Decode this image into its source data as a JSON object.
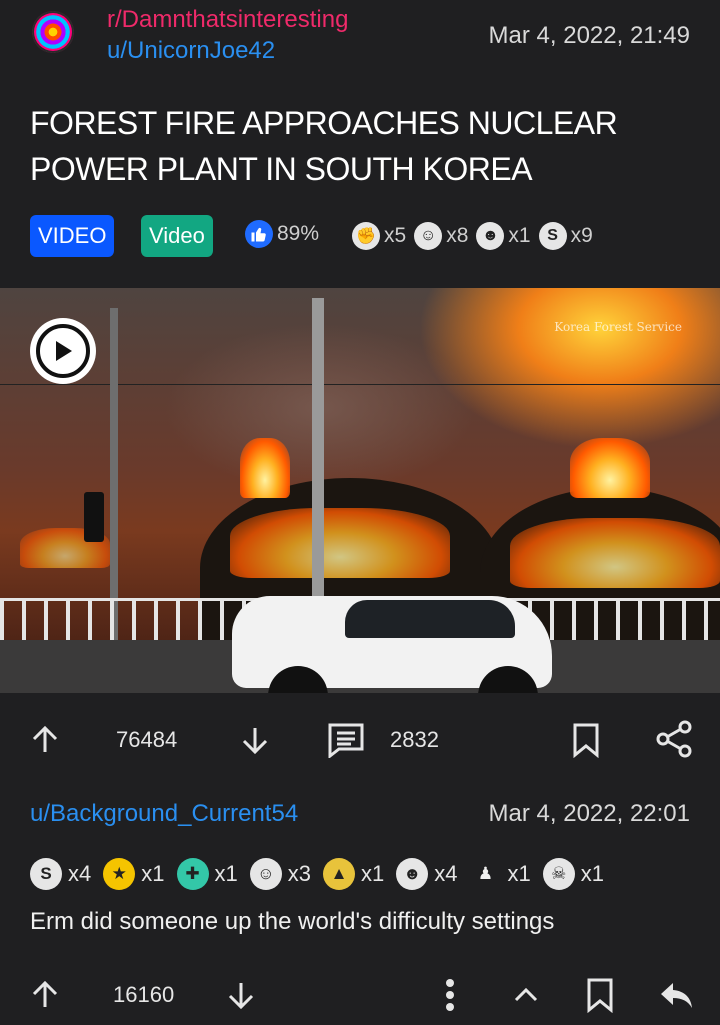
{
  "post": {
    "subreddit": "r/Damnthatsinteresting",
    "author": "u/UnicornJoe42",
    "timestamp": "Mar 4, 2022, 21:49",
    "title": "FOREST FIRE APPROACHES NUCLEAR POWER PLANT IN SOUTH KOREA",
    "flairs": [
      "VIDEO",
      "Video"
    ],
    "upvote_ratio": "89%",
    "awards": [
      {
        "icon": "strong-arm-icon",
        "count": "x5"
      },
      {
        "icon": "smug-face-icon",
        "count": "x8"
      },
      {
        "icon": "anime-face-icon",
        "count": "x1"
      },
      {
        "icon": "silver-award-icon",
        "count": "x9"
      }
    ],
    "media": {
      "watermark": "Korea Forest Service"
    },
    "score": "76484",
    "comments": "2832"
  },
  "comment": {
    "author": "u/Background_Current54",
    "timestamp": "Mar 4, 2022, 22:01",
    "awards": [
      {
        "icon": "silver-award-icon",
        "count": "x4"
      },
      {
        "icon": "star-wholesome-icon",
        "count": "x1"
      },
      {
        "icon": "helpful-award-icon",
        "count": "x1"
      },
      {
        "icon": "smug-face-icon",
        "count": "x3"
      },
      {
        "icon": "eye-pyramid-icon",
        "count": "x1"
      },
      {
        "icon": "snoo-face-icon",
        "count": "x4"
      },
      {
        "icon": "goose-icon",
        "count": "x1"
      },
      {
        "icon": "skull-icon",
        "count": "x1"
      }
    ],
    "body": "Erm did someone up the world's difficulty settings",
    "score": "16160"
  },
  "colors": {
    "background": "#1f1f21",
    "subreddit": "#ef2a6a",
    "link": "#2a8ff0",
    "flair_video_1": "#0a58ff",
    "flair_video_2": "#12a782",
    "ratio_icon": "#1f6bff"
  }
}
